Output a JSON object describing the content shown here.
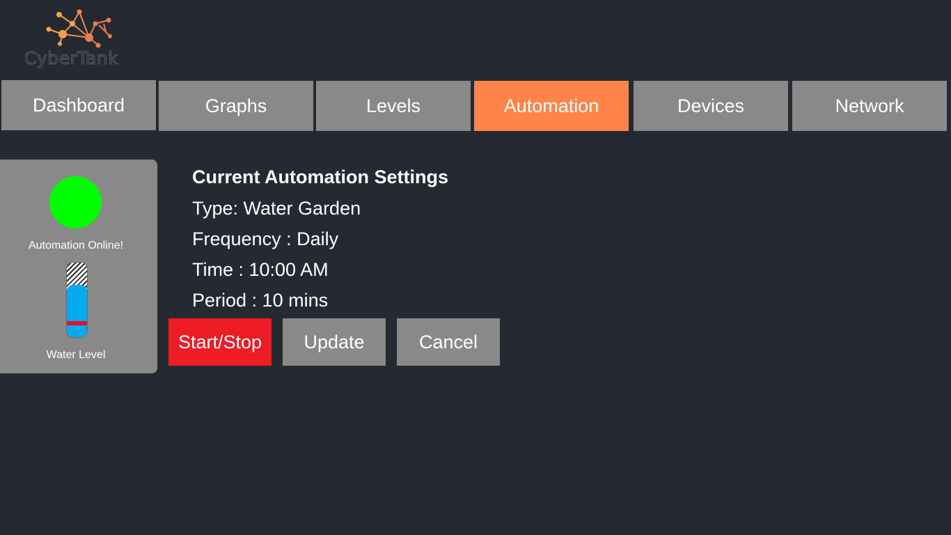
{
  "app": {
    "logo_text": "CyberTank"
  },
  "nav": {
    "tabs": [
      {
        "label": "Dashboard",
        "active": false
      },
      {
        "label": "Graphs",
        "active": false
      },
      {
        "label": "Levels",
        "active": false
      },
      {
        "label": "Automation",
        "active": true
      },
      {
        "label": "Devices",
        "active": false
      },
      {
        "label": "Network",
        "active": false
      }
    ]
  },
  "status_panel": {
    "status_text": "Automation Online!",
    "status_color": "#00ff00",
    "water_level_label": "Water Level",
    "water_level_fraction": 0.7,
    "level_marker_color": "#e2111f",
    "icons": [
      "status-indicator-icon",
      "water-level-gauge-icon"
    ]
  },
  "settings": {
    "title": "Current Automation Settings",
    "type_line": "Type: Water Garden",
    "frequency_line": "Frequency : Daily",
    "time_line": "Time : 10:00 AM",
    "period_line": "Period : 10 mins"
  },
  "actions": {
    "start_stop_label": "Start/Stop",
    "update_label": "Update",
    "cancel_label": "Cancel"
  },
  "colors": {
    "background": "#252a32",
    "tab": "#898989",
    "accent": "#ff8449",
    "danger": "#ee1c25",
    "water": "#05aaf0"
  }
}
